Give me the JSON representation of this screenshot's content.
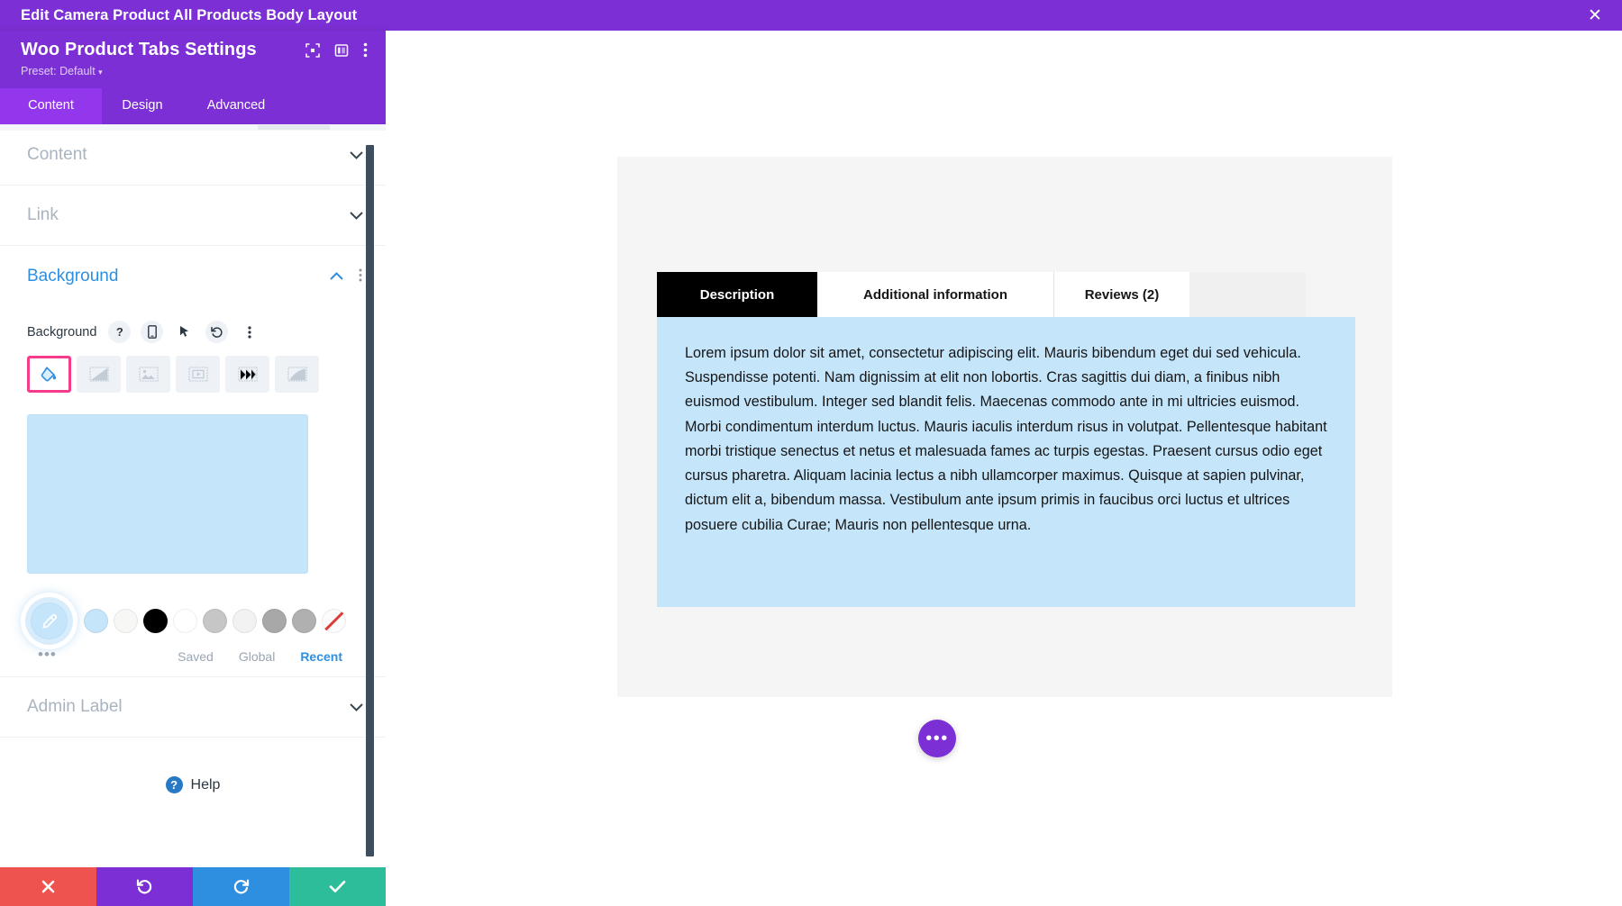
{
  "topbar": {
    "title": "Edit Camera Product All Products Body Layout",
    "close_icon": "close-icon",
    "close_glyph": "✕",
    "background_color": "#7b2fd4"
  },
  "panel": {
    "title": "Woo Product Tabs Settings",
    "preset_label": "Preset: Default",
    "preset_caret": "▾",
    "header_icons": [
      "focus-icon",
      "layout-panel-icon",
      "more-vertical-icon"
    ],
    "tabs": [
      {
        "label": "Content",
        "active": true
      },
      {
        "label": "Design",
        "active": false
      },
      {
        "label": "Advanced",
        "active": false
      }
    ],
    "accordions": [
      {
        "label": "Content",
        "open": false,
        "chevron": "chevron-down-icon"
      },
      {
        "label": "Link",
        "open": false,
        "chevron": "chevron-down-icon"
      },
      {
        "label": "Background",
        "open": true,
        "chevron": "chevron-up-icon"
      },
      {
        "label": "Admin Label",
        "open": false,
        "chevron": "chevron-down-icon"
      }
    ],
    "background": {
      "field_label": "Background",
      "controls": [
        {
          "name": "help-icon",
          "glyph": "?"
        },
        {
          "name": "responsive-mobile-icon",
          "glyph": ""
        },
        {
          "name": "hover-cursor-icon",
          "glyph": ""
        },
        {
          "name": "reset-icon",
          "glyph": ""
        },
        {
          "name": "more-options-icon",
          "glyph": ""
        }
      ],
      "types": [
        {
          "name": "background-color-type",
          "active": true
        },
        {
          "name": "background-gradient-type",
          "active": false
        },
        {
          "name": "background-image-type",
          "active": false
        },
        {
          "name": "background-video-type",
          "active": false
        },
        {
          "name": "background-pattern-type",
          "active": false
        },
        {
          "name": "background-mask-type",
          "active": false
        }
      ],
      "selected_color": "#c5e5fb",
      "eyedropper_icon": "eyedropper-icon",
      "swatches": [
        "#c5e5fb",
        "#f7f7f5",
        "#000000",
        "#ffffff",
        "#c6c6c6",
        "#f2f2f2",
        "#a8a8a8",
        "#b0b0b0"
      ],
      "transparent_swatch": "none",
      "more_colors": "•••",
      "source_tabs": [
        {
          "label": "Saved",
          "active": false
        },
        {
          "label": "Global",
          "active": false
        },
        {
          "label": "Recent",
          "active": true
        }
      ]
    },
    "help": {
      "label": "Help",
      "badge": "?"
    },
    "actions": [
      {
        "name": "cancel-button",
        "color": "#ef5350"
      },
      {
        "name": "undo-button",
        "color": "#7b2fd4"
      },
      {
        "name": "redo-button",
        "color": "#2e8fe0"
      },
      {
        "name": "save-button",
        "color": "#2dbd9a"
      }
    ]
  },
  "preview": {
    "card_background": "#f5f5f5",
    "tabs": [
      {
        "label": "Description",
        "active": true
      },
      {
        "label": "Additional information",
        "active": false
      },
      {
        "label": "Reviews (2)",
        "active": false
      }
    ],
    "panel_background": "#c5e5fb",
    "body_text": "Lorem ipsum dolor sit amet, consectetur adipiscing elit. Mauris bibendum eget dui sed vehicula. Suspendisse potenti. Nam dignissim at elit non lobortis. Cras sagittis dui diam, a finibus nibh euismod vestibulum. Integer sed blandit felis. Maecenas commodo ante in mi ultricies euismod. Morbi condimentum interdum luctus. Mauris iaculis interdum risus in volutpat. Pellentesque habitant morbi tristique senectus et netus et malesuada fames ac turpis egestas. Praesent cursus odio eget cursus pharetra. Aliquam lacinia lectus a nibh ullamcorper maximus. Quisque at sapien pulvinar, dictum elit a, bibendum massa. Vestibulum ante ipsum primis in faucibus orci luctus et ultrices posuere cubilia Curae; Mauris non pellentesque urna.",
    "fab": {
      "name": "page-settings-fab",
      "glyph": "•••",
      "color": "#7b2fd4"
    }
  }
}
